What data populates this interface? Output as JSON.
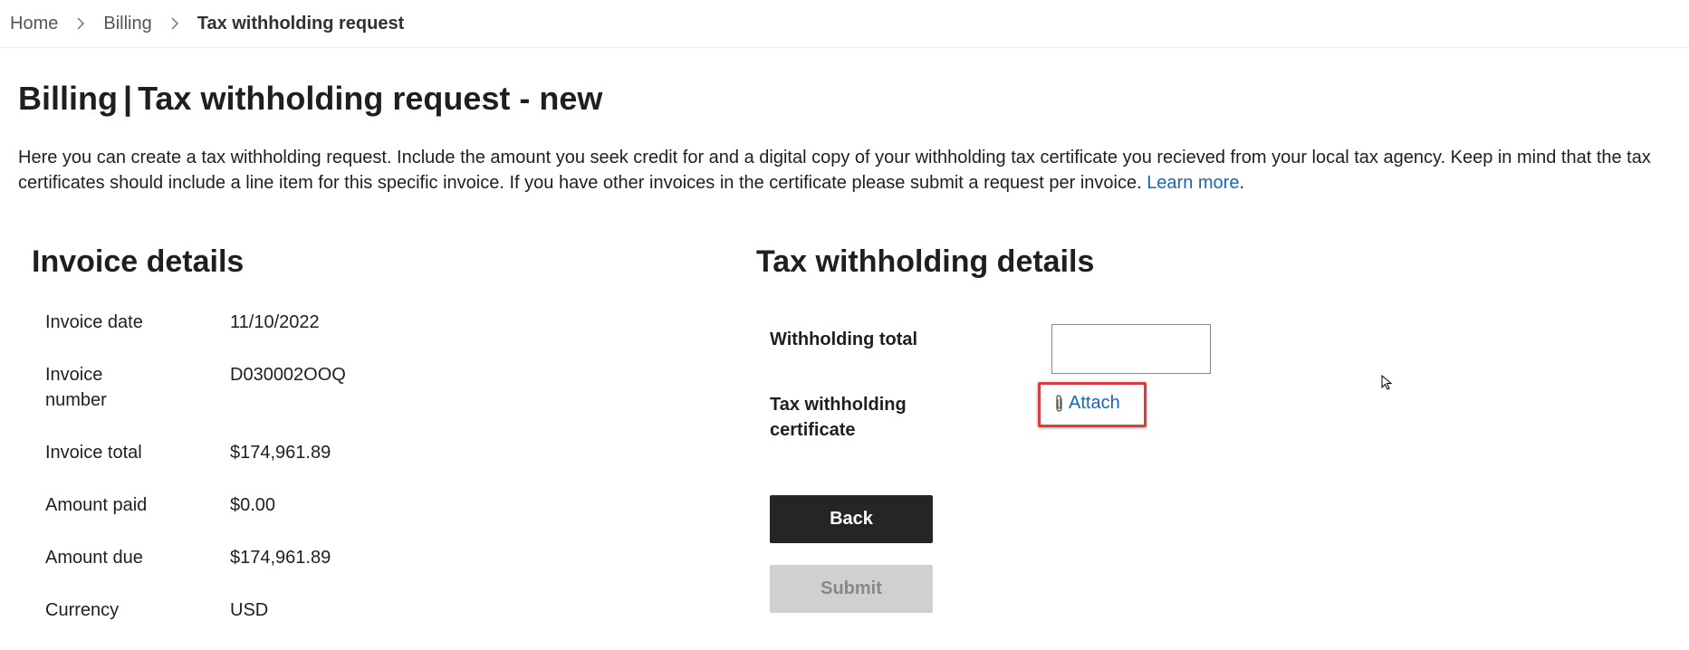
{
  "breadcrumb": {
    "items": [
      "Home",
      "Billing"
    ],
    "current": "Tax withholding request"
  },
  "page": {
    "title_bold": "Billing",
    "title_separator": "|",
    "title_rest": "Tax withholding request - new",
    "intro_text": "Here you can create a tax withholding request. Include the amount you seek credit for and a digital copy of your withholding tax certificate you recieved from your local tax agency. Keep in mind that the tax certificates should include a line item for this specific invoice. If you have other invoices in the certificate please submit a request per invoice.",
    "learn_more": "Learn more",
    "learn_more_suffix": "."
  },
  "invoice": {
    "heading": "Invoice details",
    "rows": [
      {
        "label": "Invoice date",
        "value": "11/10/2022"
      },
      {
        "label": "Invoice number",
        "value": "D030002OOQ"
      },
      {
        "label": "Invoice total",
        "value": "$174,961.89"
      },
      {
        "label": "Amount paid",
        "value": "$0.00"
      },
      {
        "label": "Amount due",
        "value": "$174,961.89"
      },
      {
        "label": "Currency",
        "value": "USD"
      }
    ]
  },
  "tax": {
    "heading": "Tax withholding details",
    "withholding_label": "Withholding total",
    "withholding_value": "",
    "certificate_label": "Tax withholding certificate",
    "attach_label": "Attach",
    "attach_icon": "paperclip-icon",
    "back_label": "Back",
    "submit_label": "Submit"
  },
  "colors": {
    "link": "#1a66b5",
    "highlight": "#e0393e",
    "button_dark": "#252525",
    "button_disabled": "#d2d0ce"
  }
}
